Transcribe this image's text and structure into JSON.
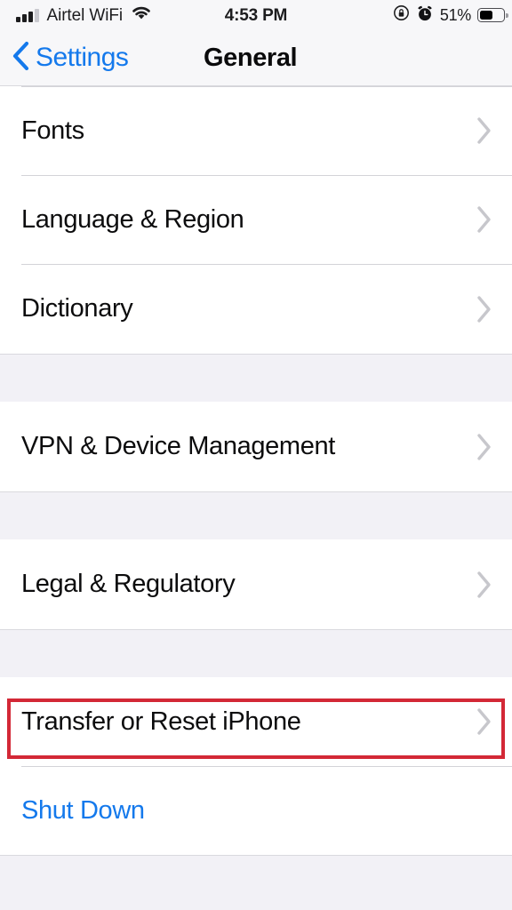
{
  "status_bar": {
    "carrier": "Airtel WiFi",
    "signal_icon": "signal-bars-icon",
    "wifi_icon": "wifi-icon",
    "time": "4:53 PM",
    "rotation_lock_icon": "rotation-lock-icon",
    "alarm_icon": "alarm-clock-icon",
    "battery_percent": "51%",
    "battery_icon": "battery-icon",
    "battery_level": 51
  },
  "nav_bar": {
    "back_icon": "chevron-left-icon",
    "back_label": "Settings",
    "title": "General"
  },
  "groups": [
    {
      "id": "group-display",
      "rows": [
        {
          "label": "Fonts",
          "name": "fonts",
          "accessory": "chevron-right-icon",
          "style": "default"
        },
        {
          "label": "Language & Region",
          "name": "language-region",
          "accessory": "chevron-right-icon",
          "style": "default"
        },
        {
          "label": "Dictionary",
          "name": "dictionary",
          "accessory": "chevron-right-icon",
          "style": "default"
        }
      ]
    },
    {
      "id": "group-vpn",
      "rows": [
        {
          "label": "VPN & Device Management",
          "name": "vpn-device-management",
          "accessory": "chevron-right-icon",
          "style": "default"
        }
      ]
    },
    {
      "id": "group-legal",
      "rows": [
        {
          "label": "Legal & Regulatory",
          "name": "legal-regulatory",
          "accessory": "chevron-right-icon",
          "style": "default"
        }
      ]
    },
    {
      "id": "group-reset",
      "rows": [
        {
          "label": "Transfer or Reset iPhone",
          "name": "transfer-or-reset-iphone",
          "accessory": "chevron-right-icon",
          "style": "default"
        },
        {
          "label": "Shut Down",
          "name": "shut-down",
          "accessory": "none",
          "style": "accent"
        }
      ]
    }
  ],
  "highlight": {
    "target": "Transfer or Reset iPhone",
    "color": "#d32836"
  },
  "colors": {
    "accent_blue": "#1479ec",
    "group_background": "#f2f1f6",
    "row_background": "#ffffff",
    "separator": "#d3d3d8",
    "chevron": "#c7c7cc",
    "text_primary": "#0c0c0d",
    "highlight_red": "#d32836"
  }
}
